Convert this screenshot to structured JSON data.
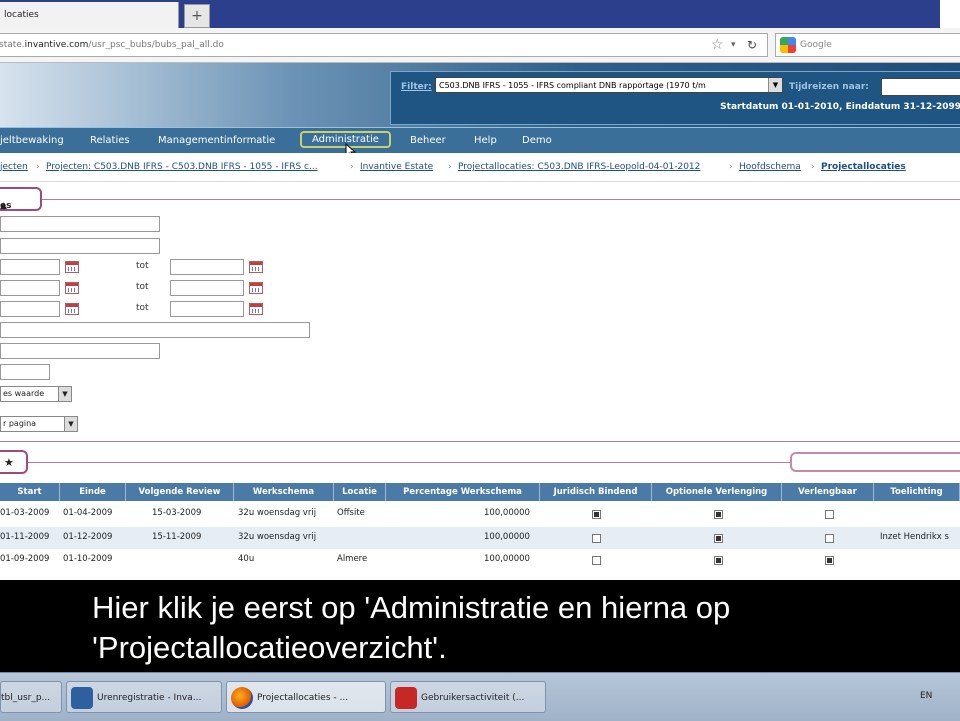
{
  "browser": {
    "tab_title": "locaties",
    "new_tab_symbol": "+",
    "url_prefix": "state.",
    "url_host": "invantive.com",
    "url_path": "/usr_psc_bubs/bubs_pal_all.do",
    "search_placeholder": "Google"
  },
  "header": {
    "filter_label": "Filter:",
    "filter_value": "C503.DNB IFRS - 1055 - IFRS compliant DNB rapportage (1970 t/m",
    "tijdreizen_label": "Tijdreizen naar:",
    "date_range": "Startdatum 01-01-2010, Einddatum 31-12-2099"
  },
  "menu": {
    "items": [
      "jeltbewaking",
      "Relaties",
      "Managementinformatie",
      "Administratie",
      "Beheer",
      "Help",
      "Demo"
    ]
  },
  "breadcrumbs": [
    "jecten",
    "Projecten: C503.DNB IFRS - C503.DNB IFRS - 1055 - IFRS c...",
    "Invantive Estate",
    "Projectallocaties: C503.DNB IFRS-Leopold-04-01-2012",
    "Hoofdschema",
    "Projectallocaties"
  ],
  "form": {
    "section_label": "es",
    "section_toggle": "▲",
    "tot_label": "tot",
    "select_values_label": "es waarde",
    "select_per_page_label": "r pagina",
    "results_toggle": "★"
  },
  "table": {
    "headers": [
      "Start",
      "Einde",
      "Volgende Review",
      "Werkschema",
      "Locatie",
      "Percentage Werkschema",
      "Juridisch Bindend",
      "Optionele Verlenging",
      "Verlengbaar",
      "Toelichting"
    ],
    "rows": [
      {
        "start": "01-03-2009",
        "einde": "01-04-2009",
        "review": "15-03-2009",
        "werkschema": "32u woensdag vrij",
        "locatie": "Offsite",
        "percentage": "100,00000",
        "juridisch": true,
        "optioneel": true,
        "verlengbaar": false,
        "toelichting": ""
      },
      {
        "start": "01-11-2009",
        "einde": "01-12-2009",
        "review": "15-11-2009",
        "werkschema": "32u woensdag vrij",
        "locatie": "",
        "percentage": "100,00000",
        "juridisch": false,
        "optioneel": true,
        "verlengbaar": false,
        "toelichting": "Inzet Hendrikx s"
      },
      {
        "start": "01-09-2009",
        "einde": "01-10-2009",
        "review": "",
        "werkschema": "40u",
        "locatie": "Almere",
        "percentage": "100,00000",
        "juridisch": false,
        "optioneel": true,
        "verlengbaar": true,
        "toelichting": ""
      }
    ]
  },
  "subtitle": {
    "line1": "Hier klik je eerst op 'Administratie en hierna op",
    "line2": "'Projectallocatieoverzicht'."
  },
  "taskbar": {
    "items": [
      "tbl_usr_p...",
      "Urenregistratie - Inva...",
      "Projectallocaties - ...",
      "Gebruikersactiviteit (..."
    ],
    "language": "EN"
  },
  "colors": {
    "menu_bg": "#3a6f9a",
    "table_header_bg": "#4a7aa5",
    "section_border": "#a04a7a",
    "link": "#1f4e8c"
  },
  "icons": [
    "new-tab-icon",
    "bookmark-star-icon",
    "reload-icon",
    "google-icon",
    "calendar-icon",
    "mouse-cursor-icon",
    "firefox-icon",
    "pdf-icon"
  ]
}
